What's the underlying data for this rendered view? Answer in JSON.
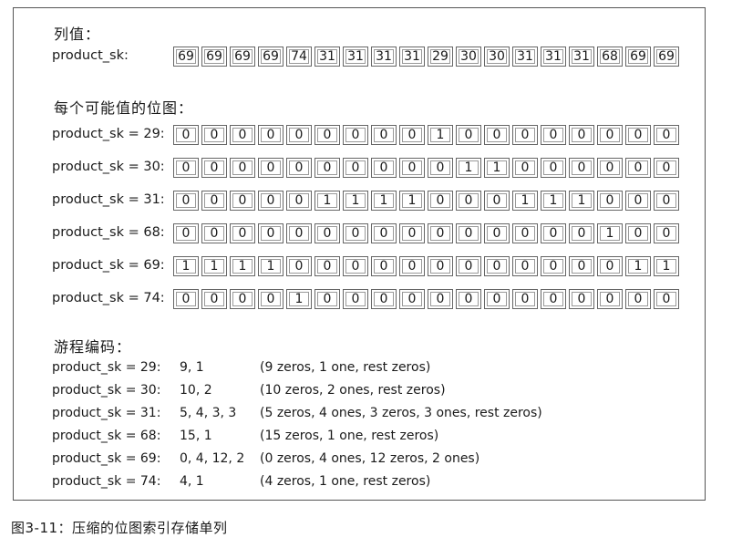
{
  "column_values": {
    "heading": "列值：",
    "label": "product_sk:",
    "values": [
      "69",
      "69",
      "69",
      "69",
      "74",
      "31",
      "31",
      "31",
      "31",
      "29",
      "30",
      "30",
      "31",
      "31",
      "31",
      "68",
      "69",
      "69"
    ]
  },
  "bitmaps": {
    "heading": "每个可能值的位图：",
    "rows": [
      {
        "label": "product_sk = 29:",
        "bits": [
          "0",
          "0",
          "0",
          "0",
          "0",
          "0",
          "0",
          "0",
          "0",
          "1",
          "0",
          "0",
          "0",
          "0",
          "0",
          "0",
          "0",
          "0"
        ]
      },
      {
        "label": "product_sk = 30:",
        "bits": [
          "0",
          "0",
          "0",
          "0",
          "0",
          "0",
          "0",
          "0",
          "0",
          "0",
          "1",
          "1",
          "0",
          "0",
          "0",
          "0",
          "0",
          "0"
        ]
      },
      {
        "label": "product_sk = 31:",
        "bits": [
          "0",
          "0",
          "0",
          "0",
          "0",
          "1",
          "1",
          "1",
          "1",
          "0",
          "0",
          "0",
          "1",
          "1",
          "1",
          "0",
          "0",
          "0"
        ]
      },
      {
        "label": "product_sk = 68:",
        "bits": [
          "0",
          "0",
          "0",
          "0",
          "0",
          "0",
          "0",
          "0",
          "0",
          "0",
          "0",
          "0",
          "0",
          "0",
          "0",
          "1",
          "0",
          "0"
        ]
      },
      {
        "label": "product_sk = 69:",
        "bits": [
          "1",
          "1",
          "1",
          "1",
          "0",
          "0",
          "0",
          "0",
          "0",
          "0",
          "0",
          "0",
          "0",
          "0",
          "0",
          "0",
          "1",
          "1"
        ]
      },
      {
        "label": "product_sk = 74:",
        "bits": [
          "0",
          "0",
          "0",
          "0",
          "1",
          "0",
          "0",
          "0",
          "0",
          "0",
          "0",
          "0",
          "0",
          "0",
          "0",
          "0",
          "0",
          "0"
        ]
      }
    ]
  },
  "run_length": {
    "heading": "游程编码：",
    "rows": [
      {
        "label": "product_sk = 29:",
        "code": "9, 1",
        "note": "(9 zeros, 1 one, rest zeros)"
      },
      {
        "label": "product_sk = 30:",
        "code": "10, 2",
        "note": "(10 zeros, 2 ones, rest zeros)"
      },
      {
        "label": "product_sk = 31:",
        "code": "5, 4, 3, 3",
        "note": "(5 zeros, 4 ones, 3 zeros, 3 ones, rest zeros)"
      },
      {
        "label": "product_sk = 68:",
        "code": "15, 1",
        "note": "(15 zeros, 1 one, rest zeros)"
      },
      {
        "label": "product_sk = 69:",
        "code": "0, 4, 12, 2",
        "note": "(0 zeros, 4 ones, 12 zeros, 2 ones)"
      },
      {
        "label": "product_sk = 74:",
        "code": "4, 1",
        "note": "(4 zeros, 1 one, rest zeros)"
      }
    ]
  },
  "caption": "图3-11：压缩的位图索引存储单列"
}
